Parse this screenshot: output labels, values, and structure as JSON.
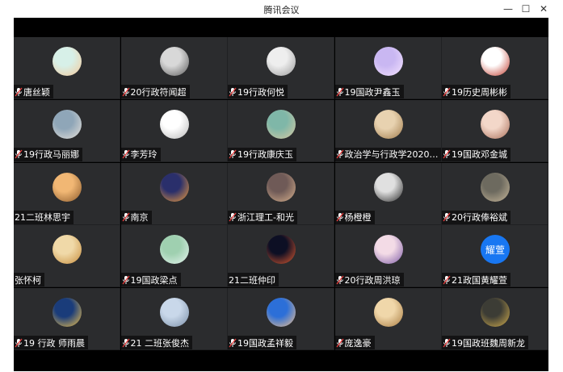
{
  "window": {
    "title": "腾讯会议"
  },
  "controls": {
    "minimize": "—",
    "maximize": "☐",
    "close": "✕"
  },
  "participants": [
    {
      "name": "唐丝颖",
      "mic": true,
      "avatar_colors": [
        "#d7f0e8",
        "#f4c99b"
      ]
    },
    {
      "name": "20行政符闻超",
      "mic": true,
      "avatar_colors": [
        "#d8d8d8",
        "#5b5b5b"
      ]
    },
    {
      "name": "19行政何悦",
      "mic": true,
      "avatar_colors": [
        "#eeeeee",
        "#9a9a9a"
      ]
    },
    {
      "name": "19国政尹鑫玉",
      "mic": true,
      "avatar_colors": [
        "#c9b7f2",
        "#f6e4ff"
      ]
    },
    {
      "name": "19历史周彬彬",
      "mic": true,
      "avatar_colors": [
        "#ffffff",
        "#c0392b"
      ]
    },
    {
      "name": "19行政马丽娜",
      "mic": true,
      "avatar_colors": [
        "#8fa6b8",
        "#e8e2da"
      ]
    },
    {
      "name": "李芳玲",
      "mic": true,
      "avatar_colors": [
        "#ffffff",
        "#b8b8b8"
      ]
    },
    {
      "name": "19行政康庆玉",
      "mic": true,
      "avatar_colors": [
        "#7fb7a8",
        "#d9c9a2"
      ]
    },
    {
      "name": "政治学与行政学2020…",
      "mic": true,
      "avatar_colors": [
        "#e8d2b0",
        "#9f7a4a"
      ]
    },
    {
      "name": "19国政邓金城",
      "mic": true,
      "avatar_colors": [
        "#f3d7c9",
        "#a86d58"
      ]
    },
    {
      "name": "21二班林思宇",
      "mic": false,
      "avatar_colors": [
        "#f1b774",
        "#8b5a2b"
      ]
    },
    {
      "name": "南京",
      "mic": true,
      "avatar_colors": [
        "#2a2f6b",
        "#f19d3b"
      ]
    },
    {
      "name": "浙江理工-和光",
      "mic": true,
      "avatar_colors": [
        "#6f5a57",
        "#d7b08d"
      ]
    },
    {
      "name": "杨橙橙",
      "mic": true,
      "avatar_colors": [
        "#e0e0e0",
        "#2a2a2a"
      ]
    },
    {
      "name": "20行政俸裕斌",
      "mic": true,
      "avatar_colors": [
        "#6d6a5f",
        "#c7b79a"
      ]
    },
    {
      "name": "张怀柯",
      "mic": false,
      "avatar_colors": [
        "#f0d9a8",
        "#c78d3b"
      ]
    },
    {
      "name": "19国政梁点",
      "mic": true,
      "avatar_colors": [
        "#9fd0b0",
        "#e7f4f0"
      ]
    },
    {
      "name": "21二班仲印",
      "mic": false,
      "avatar_colors": [
        "#0d0f24",
        "#e05b30"
      ]
    },
    {
      "name": "20行政周洪琼",
      "mic": true,
      "avatar_colors": [
        "#f3dbe6",
        "#7c5aa6"
      ]
    },
    {
      "name": "21政国黄耀萱",
      "mic": true,
      "avatar_colors": [
        "#1877f2",
        "#1877f2"
      ],
      "avatar_text": "耀萱"
    },
    {
      "name": "19 行政 师雨晨",
      "mic": true,
      "avatar_colors": [
        "#1a3c7a",
        "#f4c44a"
      ]
    },
    {
      "name": "21 二班张俊杰",
      "mic": true,
      "avatar_colors": [
        "#c9d8ea",
        "#7a8ea7"
      ]
    },
    {
      "name": "19国政孟祥毅",
      "mic": true,
      "avatar_colors": [
        "#2c6fd8",
        "#f2c08b"
      ]
    },
    {
      "name": "庞逸豪",
      "mic": true,
      "avatar_colors": [
        "#f0d7aa",
        "#a77a3f"
      ]
    },
    {
      "name": "19国政班魏周新龙",
      "mic": true,
      "avatar_colors": [
        "#3c3c35",
        "#d5b04d"
      ]
    }
  ]
}
